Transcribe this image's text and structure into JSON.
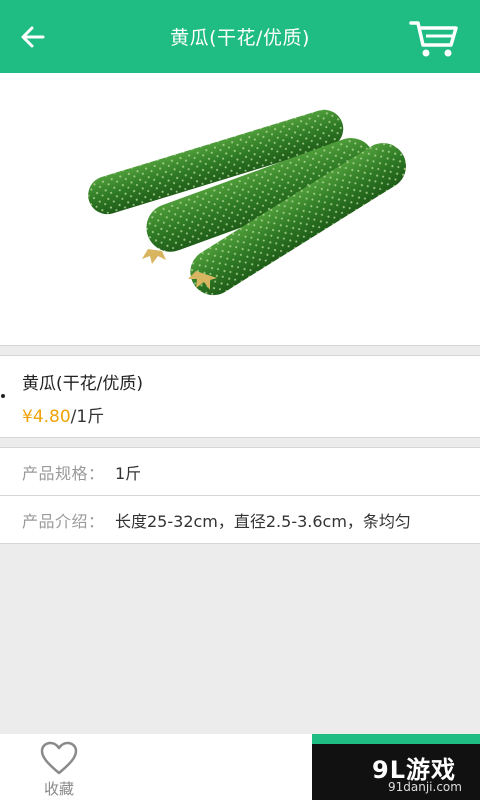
{
  "header": {
    "title": "黄瓜(干花/优质)",
    "back_icon": "arrow-left-icon",
    "cart_icon": "shopping-cart-icon",
    "color": "#1fbc83"
  },
  "product": {
    "image_subject": "cucumbers",
    "name": "黄瓜(干花/优质)",
    "price": "¥4.80",
    "unit": "/1斤",
    "price_color": "#f0a30a"
  },
  "specs": {
    "size_label": "产品规格：",
    "size_value": "1斤",
    "intro_label": "产品介绍：",
    "intro_value": "长度25-32cm，直径2.5-3.6cm，条均匀"
  },
  "bottom_bar": {
    "favorite_icon": "heart-icon",
    "favorite_label": "收藏",
    "action_color": "#1fbc83"
  },
  "watermark": {
    "logo_text": "9L游戏",
    "site": "91danji.com"
  }
}
